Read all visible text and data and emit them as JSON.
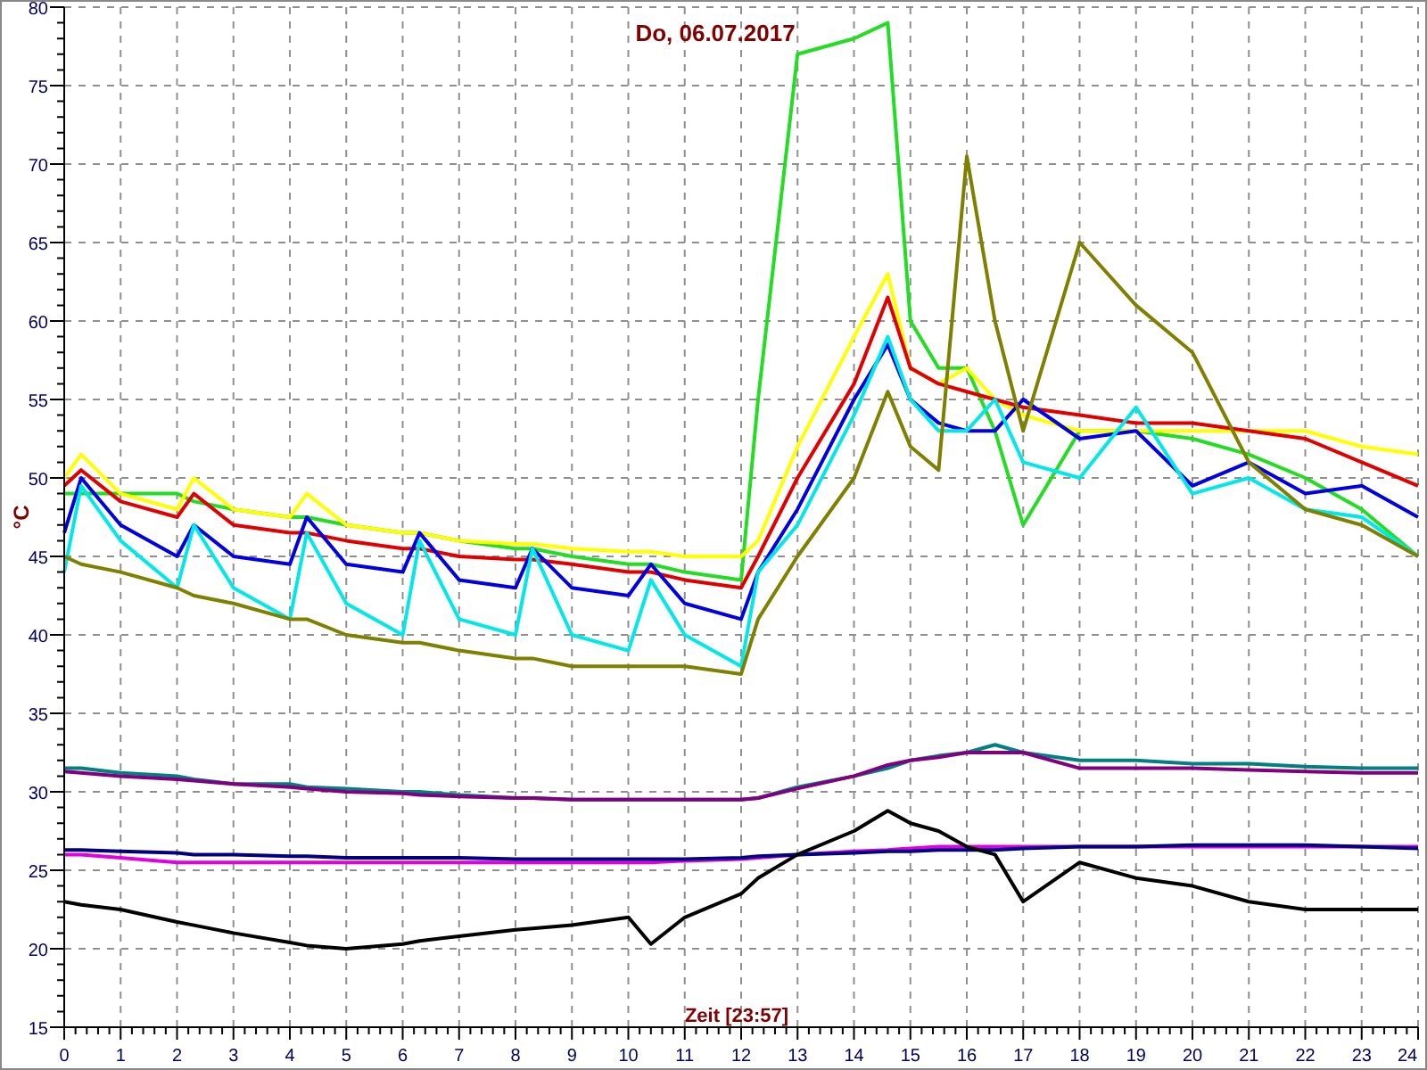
{
  "chart": {
    "chart_data": {
      "type": "line",
      "title": "Do, 06.07.2017",
      "xlabel": "Zeit [23:57]",
      "ylabel": "°C",
      "x": [
        0,
        0.3,
        1,
        2,
        2.3,
        3,
        4,
        4.3,
        5,
        6,
        6.3,
        7,
        8,
        8.3,
        9,
        10,
        10.4,
        11,
        12,
        12.3,
        13,
        14,
        14.6,
        15,
        15.5,
        16,
        16.5,
        17,
        18,
        19,
        20,
        21,
        22,
        23,
        24
      ],
      "grid": true,
      "xlim": [
        0,
        24
      ],
      "ylim": [
        15,
        80
      ],
      "xticks": [
        0,
        1,
        2,
        3,
        4,
        5,
        6,
        7,
        8,
        9,
        10,
        11,
        12,
        13,
        14,
        15,
        16,
        17,
        18,
        19,
        20,
        21,
        22,
        23,
        24
      ],
      "yticks": [
        15,
        20,
        25,
        30,
        35,
        40,
        45,
        50,
        55,
        60,
        65,
        70,
        75,
        80
      ],
      "series": [
        {
          "color": "#22dd22",
          "values": [
            49,
            49,
            49,
            49,
            48.5,
            48,
            47.5,
            47.5,
            47,
            46.5,
            46.5,
            46,
            45.5,
            45.5,
            45,
            44.5,
            44.5,
            44,
            43.5,
            55,
            77,
            78,
            79,
            60,
            57,
            57,
            53,
            47,
            53,
            53,
            52.5,
            51.5,
            50,
            48,
            45
          ]
        },
        {
          "color": "#ffff00",
          "values": [
            50,
            51.5,
            49,
            48,
            50,
            48,
            47.5,
            49,
            47,
            46.5,
            46.5,
            46,
            45.8,
            45.8,
            45.5,
            45.3,
            45.3,
            45,
            45,
            46,
            52,
            59,
            63,
            57,
            56,
            57,
            55,
            54,
            53,
            53,
            53,
            53,
            53,
            52,
            51.5
          ]
        },
        {
          "color": "#e00000",
          "values": [
            49.5,
            50.5,
            48.5,
            47.5,
            49,
            47,
            46.5,
            46.5,
            46,
            45.5,
            45.5,
            45,
            44.8,
            44.8,
            44.5,
            44,
            44,
            43.5,
            43,
            45,
            50,
            56,
            61.5,
            57,
            56,
            55.5,
            55,
            54.5,
            54,
            53.5,
            53.5,
            53,
            52.5,
            51,
            49.5
          ]
        },
        {
          "color": "#0000e0",
          "values": [
            46.5,
            50,
            47,
            45,
            47,
            45,
            44.5,
            47.5,
            44.5,
            44,
            46.5,
            43.5,
            43,
            45.5,
            43,
            42.5,
            44.5,
            42,
            41,
            44,
            48,
            55,
            58.5,
            55,
            53.5,
            53,
            53,
            55,
            52.5,
            53,
            49.5,
            51,
            49,
            49.5,
            47.5
          ]
        },
        {
          "color": "#00e8e8",
          "values": [
            44,
            49.5,
            46,
            43,
            47,
            43,
            41,
            46.5,
            42,
            40,
            46,
            41,
            40,
            45.5,
            40,
            39,
            43.5,
            40,
            38,
            44,
            47,
            54,
            59,
            55,
            53,
            53,
            55,
            51,
            50,
            54.5,
            49,
            50,
            48,
            47.5,
            45
          ]
        },
        {
          "color": "#808000",
          "values": [
            45,
            44.5,
            44,
            43,
            42.5,
            42,
            41,
            41,
            40,
            39.5,
            39.5,
            39,
            38.5,
            38.5,
            38,
            38,
            38,
            38,
            37.5,
            41,
            45,
            50,
            55.5,
            52,
            50.5,
            70.5,
            60,
            53,
            65,
            61,
            58,
            51,
            48,
            47,
            45
          ]
        },
        {
          "color": "#008080",
          "values": [
            31.5,
            31.5,
            31.2,
            31,
            30.8,
            30.5,
            30.5,
            30.3,
            30.2,
            30,
            30,
            29.8,
            29.6,
            29.6,
            29.5,
            29.5,
            29.5,
            29.5,
            29.5,
            29.6,
            30.3,
            31,
            31.5,
            32,
            32.3,
            32.5,
            33,
            32.5,
            32,
            32,
            31.8,
            31.8,
            31.6,
            31.5,
            31.5
          ]
        },
        {
          "color": "#800080",
          "values": [
            31.3,
            31.2,
            31,
            30.8,
            30.7,
            30.5,
            30.3,
            30.2,
            30,
            29.9,
            29.8,
            29.7,
            29.6,
            29.6,
            29.5,
            29.5,
            29.5,
            29.5,
            29.5,
            29.6,
            30.2,
            31,
            31.7,
            32,
            32.2,
            32.5,
            32.5,
            32.5,
            31.5,
            31.5,
            31.5,
            31.4,
            31.3,
            31.2,
            31.2
          ]
        },
        {
          "color": "#e000e0",
          "values": [
            26,
            26,
            25.8,
            25.5,
            25.5,
            25.5,
            25.5,
            25.5,
            25.5,
            25.5,
            25.5,
            25.5,
            25.5,
            25.5,
            25.5,
            25.5,
            25.5,
            25.6,
            25.7,
            25.8,
            26,
            26.2,
            26.3,
            26.4,
            26.5,
            26.5,
            26.5,
            26.5,
            26.5,
            26.5,
            26.5,
            26.5,
            26.5,
            26.5,
            26.5
          ]
        },
        {
          "color": "#000080",
          "values": [
            26.3,
            26.3,
            26.2,
            26.1,
            26,
            26,
            25.9,
            25.9,
            25.8,
            25.8,
            25.8,
            25.8,
            25.7,
            25.7,
            25.7,
            25.7,
            25.7,
            25.7,
            25.8,
            25.9,
            26,
            26.1,
            26.2,
            26.2,
            26.3,
            26.3,
            26.3,
            26.4,
            26.5,
            26.5,
            26.6,
            26.6,
            26.6,
            26.5,
            26.4
          ]
        },
        {
          "color": "#000000",
          "values": [
            23,
            22.8,
            22.5,
            21.7,
            21.5,
            21,
            20.4,
            20.2,
            20,
            20.3,
            20.5,
            20.8,
            21.2,
            21.3,
            21.5,
            22,
            20.3,
            22,
            23.5,
            24.5,
            26,
            27.5,
            28.8,
            28,
            27.5,
            26.5,
            26,
            23,
            25.5,
            24.5,
            24,
            23,
            22.5,
            22.5,
            22.5
          ]
        }
      ]
    }
  }
}
